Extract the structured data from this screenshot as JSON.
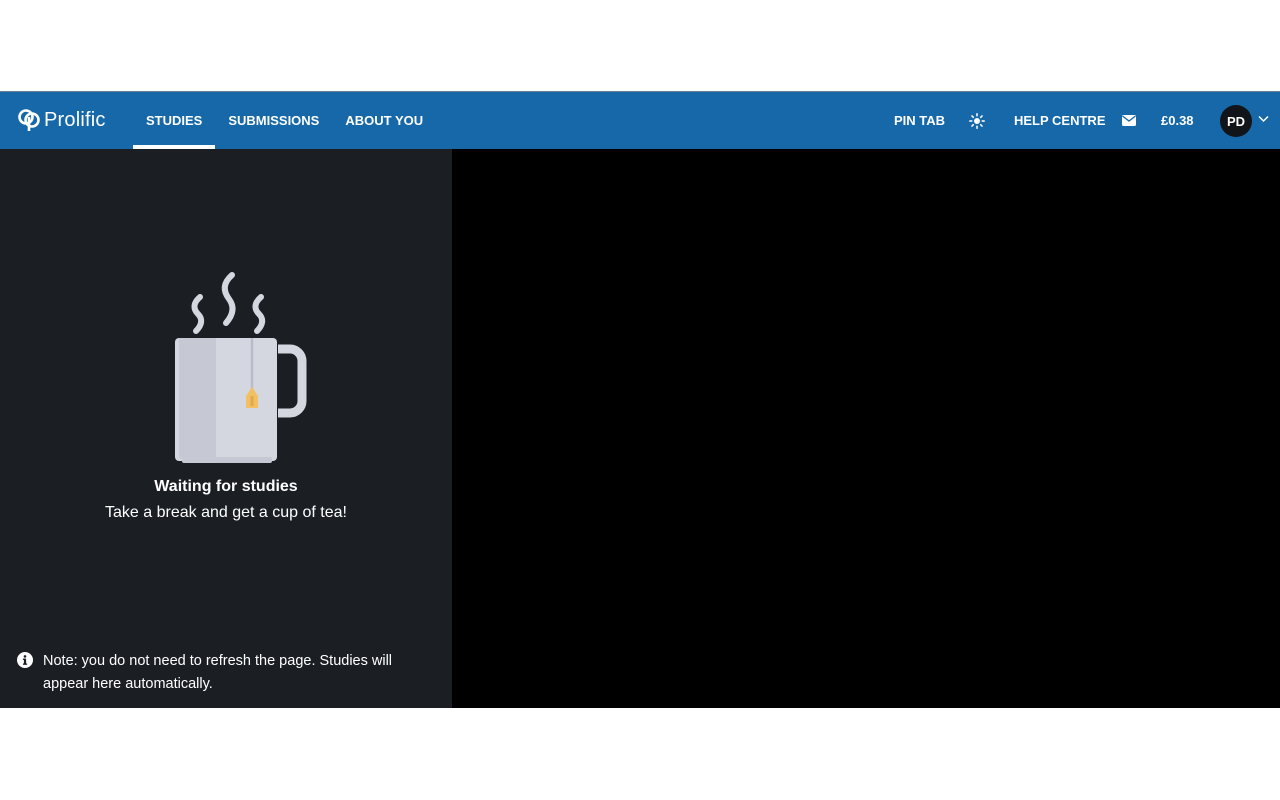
{
  "brand": {
    "name": "Prolific",
    "accent": "#1668a8"
  },
  "nav": {
    "items": [
      {
        "label": "STUDIES",
        "active": true
      },
      {
        "label": "SUBMISSIONS",
        "active": false
      },
      {
        "label": "ABOUT YOU",
        "active": false
      }
    ]
  },
  "header_right": {
    "pin_tab": "PIN TAB",
    "theme_icon": "sun-icon",
    "help_centre": "HELP CENTRE",
    "messages_icon": "envelope-icon",
    "balance": "£0.38",
    "avatar_initials": "PD",
    "menu_icon": "chevron-down-icon"
  },
  "empty_state": {
    "illustration": "tea-mug",
    "title": "Waiting for studies",
    "subtitle": "Take a break and get a cup of tea!"
  },
  "note": {
    "icon": "info-icon",
    "text": "Note: you do not need to refresh the page. Studies will appear here automatically."
  }
}
